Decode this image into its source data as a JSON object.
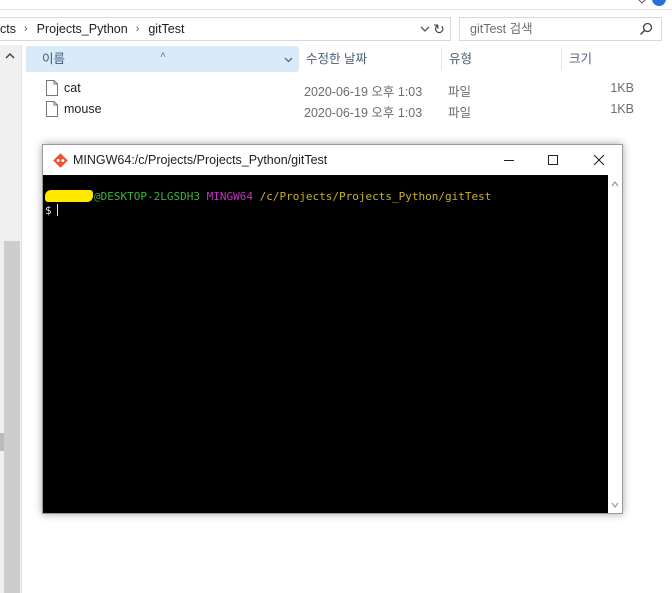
{
  "explorer": {
    "breadcrumb": [
      "cts",
      "Projects_Python",
      "gitTest"
    ],
    "search": {
      "placeholder": "gitTest 검색"
    },
    "columns": {
      "name": "이름",
      "modified": "수정한 날짜",
      "type": "유형",
      "size": "크기"
    },
    "files": [
      {
        "name": "cat",
        "modified": "2020-06-19 오후 1:03",
        "type": "파일",
        "size": "1KB"
      },
      {
        "name": "mouse",
        "modified": "2020-06-19 오후 1:03",
        "type": "파일",
        "size": "1KB"
      }
    ]
  },
  "terminal": {
    "title": "MINGW64:/c/Projects/Projects_Python/gitTest",
    "prompt_host": "@DESKTOP-2LGSDH3",
    "prompt_system": "MINGW64",
    "prompt_path": "/c/Projects/Projects_Python/gitTest",
    "prompt_symbol": "$",
    "colors": {
      "background": "#000000",
      "host": "#3cb33c",
      "system": "#c132c1",
      "path": "#c8b226",
      "username_redaction": "#ffe800"
    }
  },
  "icons": {
    "git_logo": "git-diamond-logo",
    "search": "magnifier",
    "refresh": "circular-arrow",
    "file": "blank-document"
  }
}
